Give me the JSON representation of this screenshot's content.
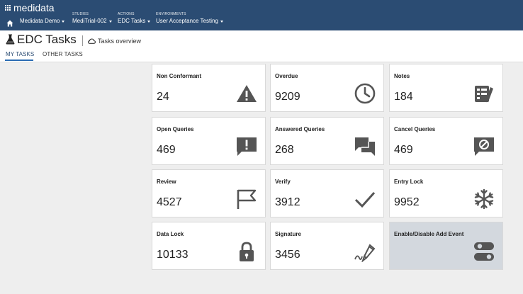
{
  "header": {
    "logo": "medidata",
    "nav": [
      {
        "caption": "",
        "value": "Medidata Demo"
      },
      {
        "caption": "STUDIES",
        "value": "MediTrial-002"
      },
      {
        "caption": "ACTIONS",
        "value": "EDC Tasks"
      },
      {
        "caption": "ENVIRONMENTS",
        "value": "User Acceptance Testing"
      }
    ]
  },
  "page": {
    "title": "EDC Tasks",
    "overview_link": "Tasks overview",
    "tabs": [
      {
        "label": "MY TASKS",
        "active": true
      },
      {
        "label": "OTHER TASKS",
        "active": false
      }
    ]
  },
  "cards": [
    {
      "label": "Non Conformant",
      "count": "24",
      "icon": "warning-icon"
    },
    {
      "label": "Overdue",
      "count": "9209",
      "icon": "clock-icon"
    },
    {
      "label": "Notes",
      "count": "184",
      "icon": "notes-icon"
    },
    {
      "label": "Open Queries",
      "count": "469",
      "icon": "exclamation-bubble-icon"
    },
    {
      "label": "Answered Queries",
      "count": "268",
      "icon": "chat-bubbles-icon"
    },
    {
      "label": "Cancel Queries",
      "count": "469",
      "icon": "cancel-bubble-icon"
    },
    {
      "label": "Review",
      "count": "4527",
      "icon": "flag-icon"
    },
    {
      "label": "Verify",
      "count": "3912",
      "icon": "checkmark-icon"
    },
    {
      "label": "Entry Lock",
      "count": "9952",
      "icon": "snowflake-icon"
    },
    {
      "label": "Data Lock",
      "count": "10133",
      "icon": "padlock-icon"
    },
    {
      "label": "Signature",
      "count": "3456",
      "icon": "pen-signature-icon"
    },
    {
      "label": "Enable/Disable Add Event",
      "count": "",
      "icon": "toggle-switch-icon"
    }
  ],
  "colors": {
    "header_bg": "#2b4c73",
    "page_bg": "#eeeeee",
    "card_bg": "#ffffff",
    "card_disabled_bg": "#d3d8de",
    "icon": "#555555",
    "tab_accent": "#2b6cb3"
  }
}
